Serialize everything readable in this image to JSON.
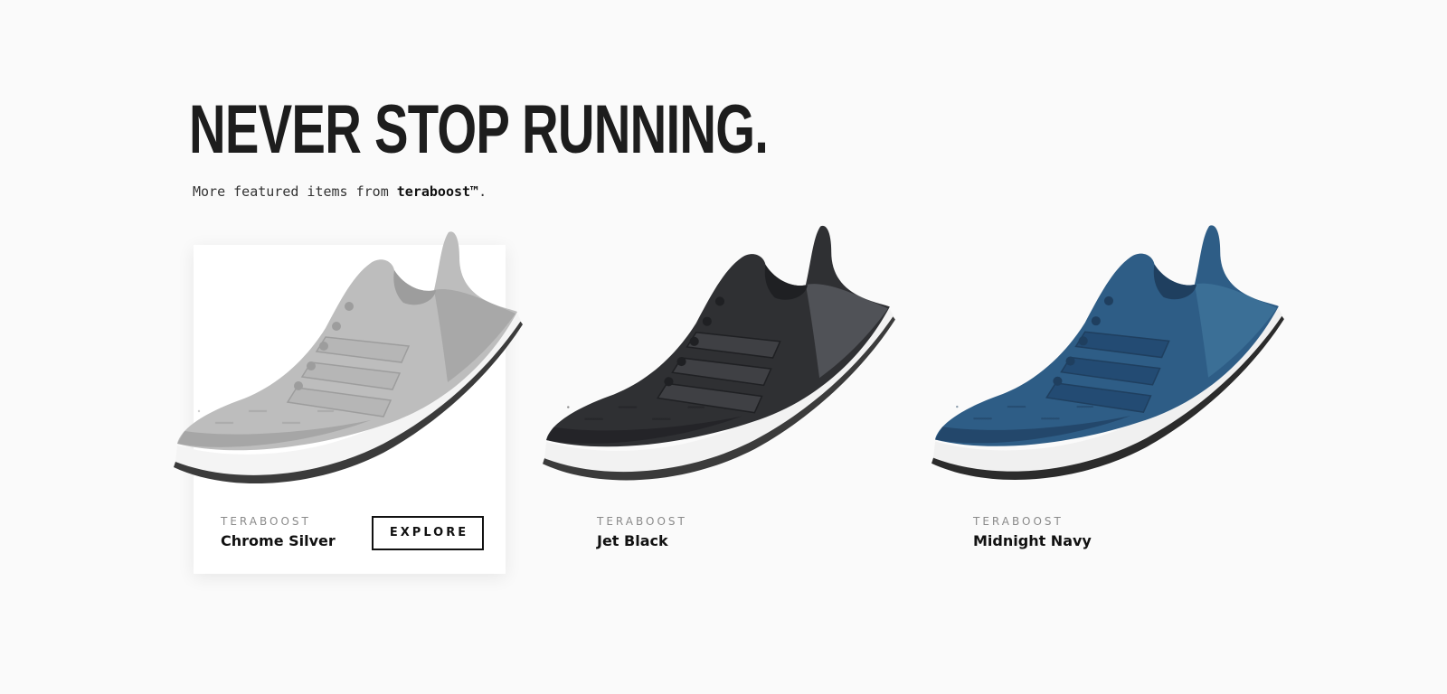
{
  "hero": {
    "title": "NEVER STOP RUNNING.",
    "subtitle_prefix": "More featured items from ",
    "subtitle_brand": "teraboost™",
    "subtitle_suffix": "."
  },
  "products": [
    {
      "brand": "TERABOOST",
      "name": "Chrome Silver",
      "cta": "EXPLORE",
      "colors": {
        "upper": "#bdbdbd",
        "upper_shadow": "#9d9d9d",
        "heel": "#a8a8a8",
        "stripes": "#b6b6b6",
        "sole": "#f4f4f4",
        "outsole": "#3b3b3b"
      }
    },
    {
      "brand": "TERABOOST",
      "name": "Jet Black",
      "colors": {
        "upper": "#2f3033",
        "upper_shadow": "#1f2023",
        "heel": "#505257",
        "stripes": "#3f4044",
        "sole": "#f2f2f2",
        "outsole": "#3b3b3b"
      }
    },
    {
      "brand": "TERABOOST",
      "name": "Midnight Navy",
      "colors": {
        "upper": "#2e5d86",
        "upper_shadow": "#1f3f5f",
        "heel": "#3b6f96",
        "stripes": "#234b73",
        "sole": "#f0f0f0",
        "outsole": "#2b2b2b"
      }
    }
  ]
}
